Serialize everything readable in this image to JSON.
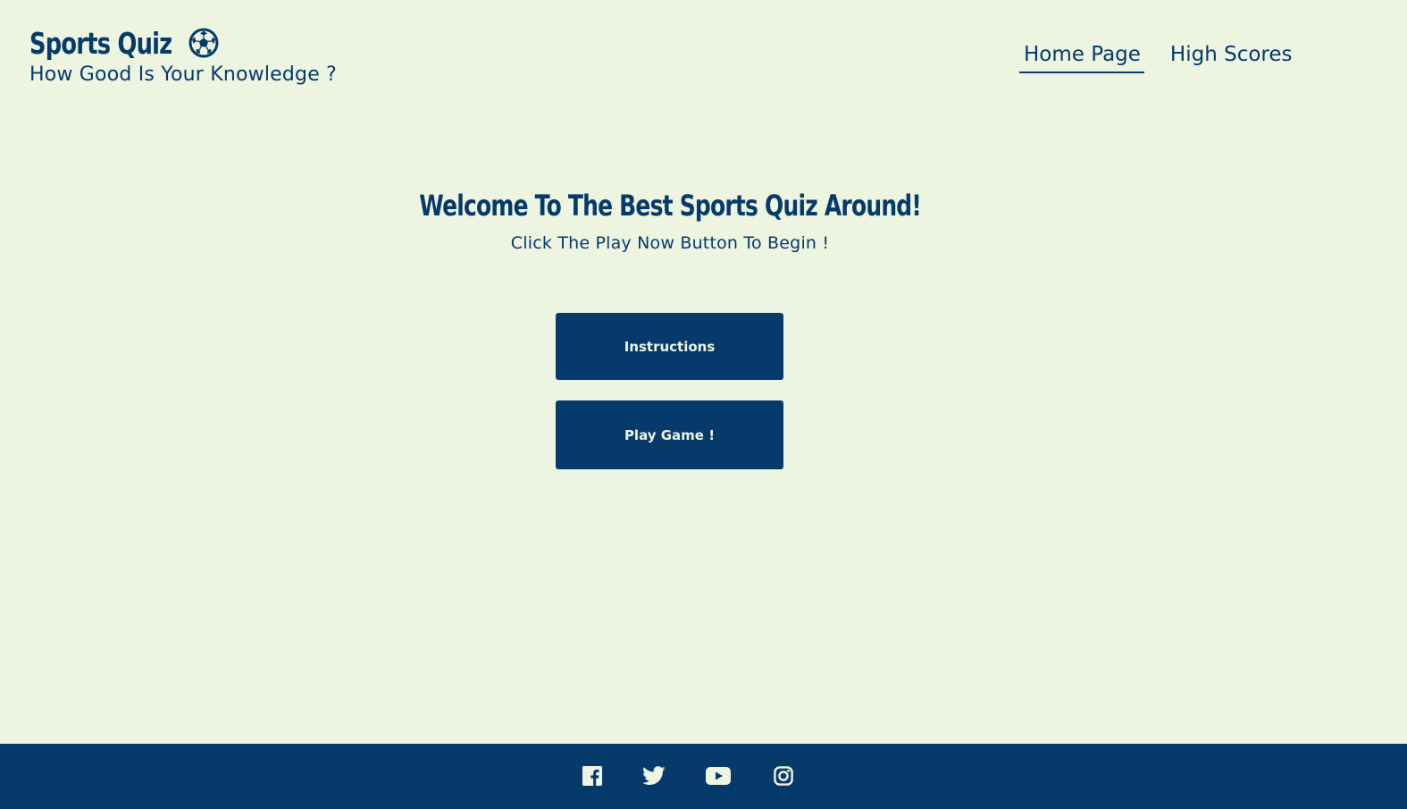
{
  "header": {
    "title": "Sports Quiz",
    "title_icon": "soccer-ball-icon",
    "tagline": "How Good Is Your Knowledge ?"
  },
  "nav": {
    "items": [
      {
        "label": "Home Page",
        "active": true
      },
      {
        "label": "High Scores",
        "active": false
      }
    ]
  },
  "main": {
    "heading": "Welcome To The Best Sports Quiz Around!",
    "subheading": "Click The Play Now Button To Begin !",
    "buttons": {
      "instructions": "Instructions",
      "play": "Play Game !"
    }
  },
  "footer": {
    "social_icons": [
      "facebook-icon",
      "twitter-icon",
      "youtube-icon",
      "instagram-icon"
    ]
  },
  "colors": {
    "background": "#edf4e0",
    "primary": "#053a6b"
  }
}
